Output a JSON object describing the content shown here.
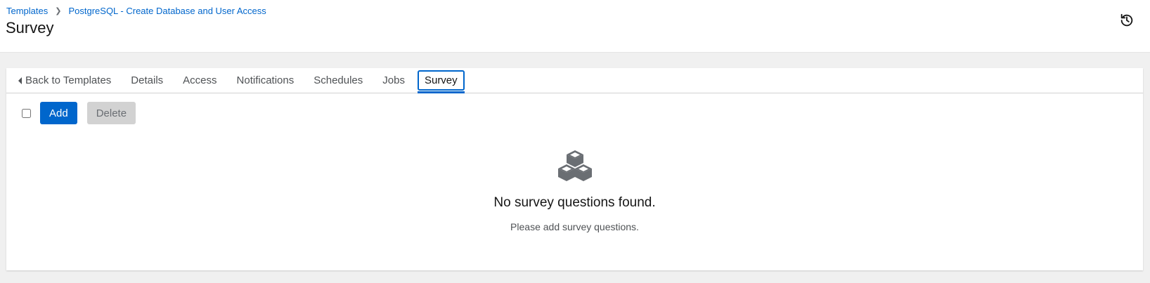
{
  "breadcrumb": {
    "items": [
      "Templates",
      "PostgreSQL - Create Database and User Access"
    ]
  },
  "header": {
    "title": "Survey",
    "history_icon": "history-icon"
  },
  "tabs": [
    {
      "label": "Back to Templates",
      "icon": "caret-left-icon"
    },
    {
      "label": "Details"
    },
    {
      "label": "Access"
    },
    {
      "label": "Notifications"
    },
    {
      "label": "Schedules"
    },
    {
      "label": "Jobs"
    },
    {
      "label": "Survey",
      "active": true
    }
  ],
  "toolbar": {
    "add_label": "Add",
    "delete_label": "Delete"
  },
  "empty_state": {
    "icon": "cubes-icon",
    "title": "No survey questions found.",
    "body": "Please add survey questions."
  },
  "colors": {
    "accent": "#0066cc",
    "disabled": "#d2d2d2"
  }
}
